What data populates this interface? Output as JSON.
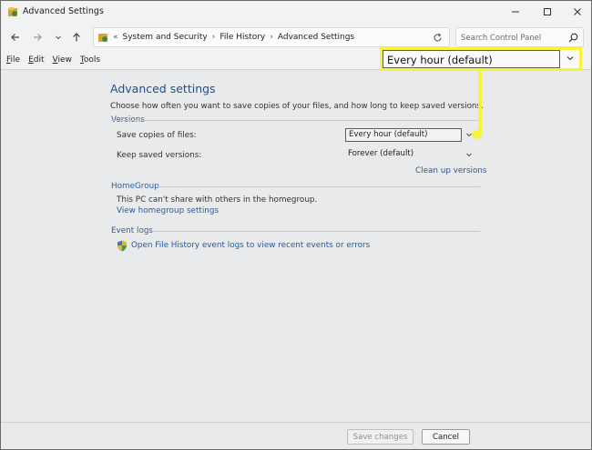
{
  "window": {
    "title": "Advanced Settings"
  },
  "address": {
    "overflow": "«",
    "crumbs": [
      "System and Security",
      "File History",
      "Advanced Settings"
    ]
  },
  "search": {
    "placeholder": "Search Control Panel"
  },
  "menu": [
    "File",
    "Edit",
    "View",
    "Tools"
  ],
  "page": {
    "heading": "Advanced settings",
    "intro": "Choose how often you want to save copies of your files, and how long to keep saved versions."
  },
  "versions": {
    "section": "Versions",
    "save_copies_label": "Save copies of files:",
    "save_copies_value": "Every hour (default)",
    "keep_label": "Keep saved versions:",
    "keep_value": "Forever (default)",
    "cleanup_link": "Clean up versions"
  },
  "homegroup": {
    "section": "HomeGroup",
    "message": "This PC can't share with others in the homegroup.",
    "link": "View homegroup settings"
  },
  "eventlogs": {
    "section": "Event logs",
    "link": "Open File History event logs to view recent events or errors"
  },
  "callout": {
    "value": "Every hour (default)"
  },
  "footer": {
    "save": "Save changes",
    "cancel": "Cancel"
  },
  "colors": {
    "accent": "#1f4e8a",
    "link": "#1f5bb0",
    "highlight": "#f7f23a"
  }
}
